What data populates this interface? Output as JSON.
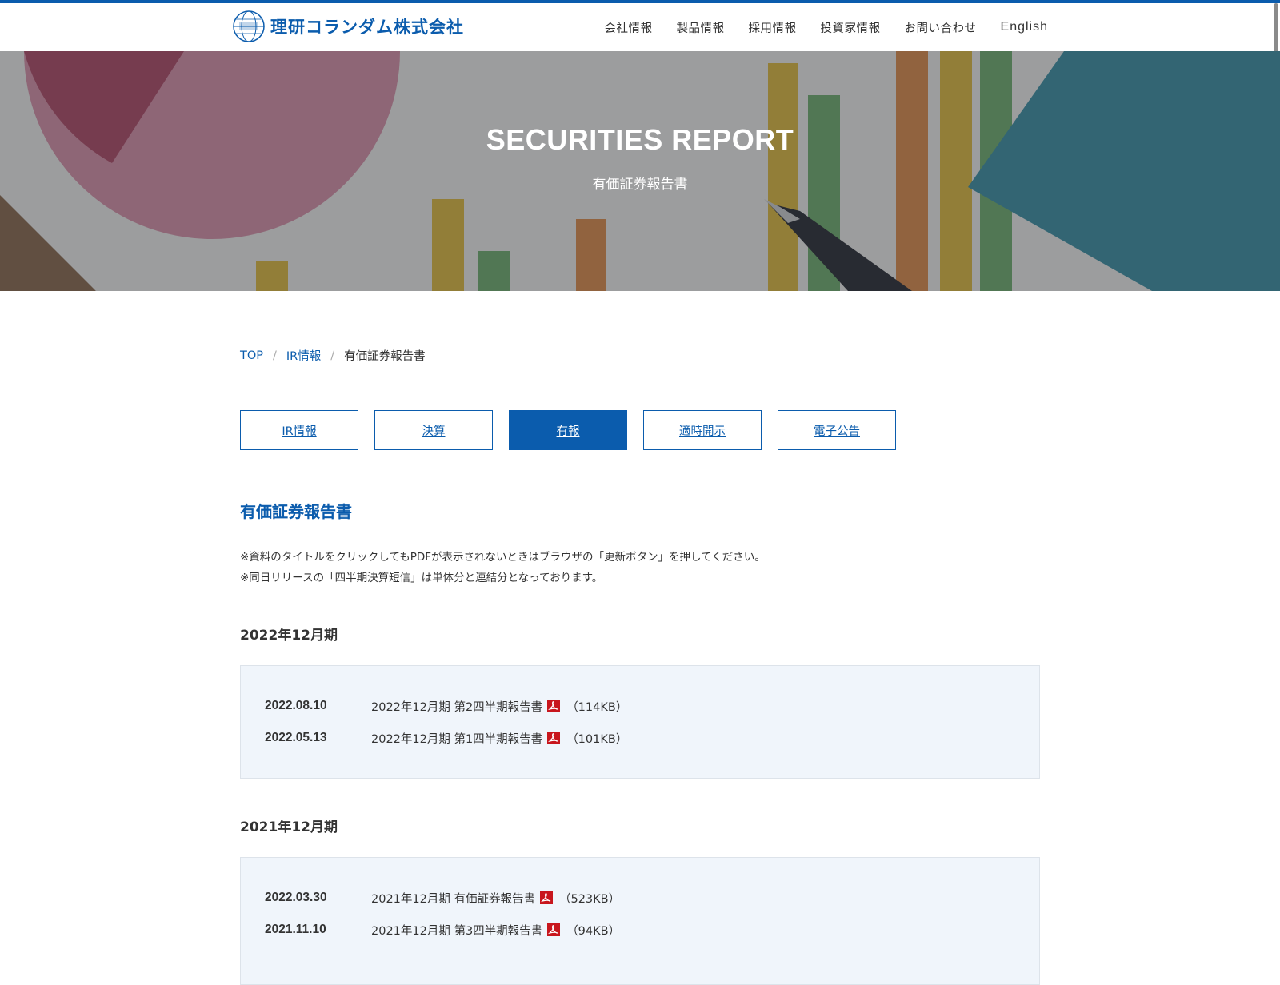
{
  "brand": {
    "name": "理研コランダム株式会社",
    "accent_color": "#0b5cad"
  },
  "nav": {
    "items": [
      {
        "label": "会社情報"
      },
      {
        "label": "製品情報"
      },
      {
        "label": "採用情報"
      },
      {
        "label": "投資家情報"
      },
      {
        "label": "お問い合わせ"
      },
      {
        "label": "English"
      }
    ]
  },
  "hero": {
    "title": "SECURITIES REPORT",
    "subtitle": "有価証券報告書"
  },
  "breadcrumb": {
    "items": [
      {
        "label": "TOP"
      },
      {
        "label": "IR情報"
      }
    ],
    "current": "有価証券報告書"
  },
  "tabs": [
    {
      "label": "IR情報",
      "active": false
    },
    {
      "label": "決算",
      "active": false
    },
    {
      "label": "有報",
      "active": true
    },
    {
      "label": "適時開示",
      "active": false
    },
    {
      "label": "電子公告",
      "active": false
    }
  ],
  "section": {
    "title": "有価証券報告書",
    "notes": [
      "※資料のタイトルをクリックしてもPDFが表示されないときはブラウザの「更新ボタン」を押してください。",
      "※同日リリースの「四半期決算短信」は単体分と連結分となっております。"
    ]
  },
  "periods": [
    {
      "heading": "2022年12月期",
      "reports": [
        {
          "date": "2022.08.10",
          "title": "2022年12月期 第2四半期報告書",
          "size": "（114KB）",
          "icon": "pdf-icon"
        },
        {
          "date": "2022.05.13",
          "title": "2022年12月期 第1四半期報告書",
          "size": "（101KB）",
          "icon": "pdf-icon"
        }
      ]
    },
    {
      "heading": "2021年12月期",
      "reports": [
        {
          "date": "2022.03.30",
          "title": "2021年12月期 有価証券報告書",
          "size": "（523KB）",
          "icon": "pdf-icon"
        },
        {
          "date": "2021.11.10",
          "title": "2021年12月期 第3四半期報告書",
          "size": "（94KB）",
          "icon": "pdf-icon"
        }
      ]
    }
  ]
}
